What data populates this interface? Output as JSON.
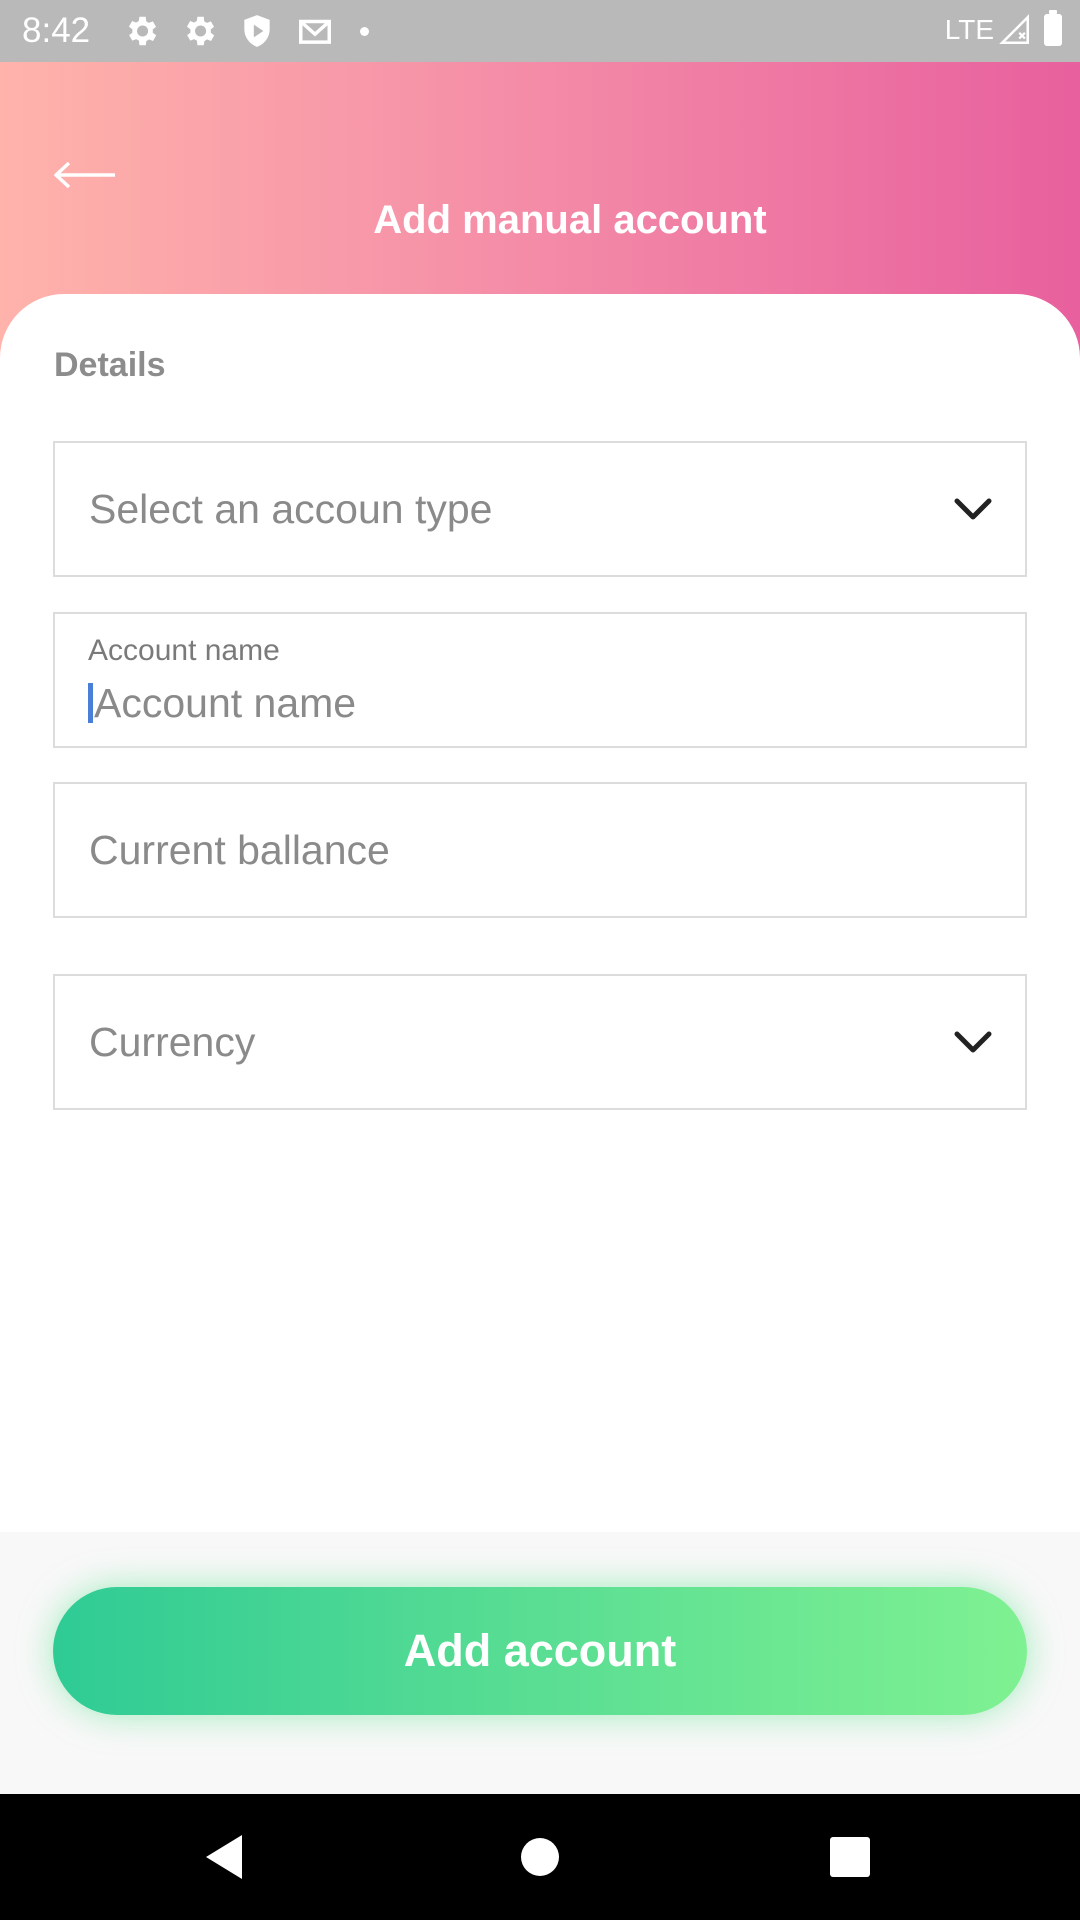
{
  "status_bar": {
    "time": "8:42",
    "network": "LTE"
  },
  "header": {
    "title": "Add manual account",
    "back_icon": "arrow-left-icon"
  },
  "form": {
    "section_label": "Details",
    "account_type": {
      "placeholder": "Select an accoun type"
    },
    "account_name": {
      "label": "Account name",
      "placeholder": "Account name"
    },
    "current_balance": {
      "placeholder": "Current ballance"
    },
    "currency": {
      "placeholder": "Currency"
    }
  },
  "footer": {
    "add_button_label": "Add account"
  },
  "colors": {
    "header_gradient_start": "#ffb3ab",
    "header_gradient_end": "#e8609e",
    "button_gradient_start": "#2fcb95",
    "button_gradient_end": "#7ff192",
    "caret": "#4a7fd8"
  }
}
